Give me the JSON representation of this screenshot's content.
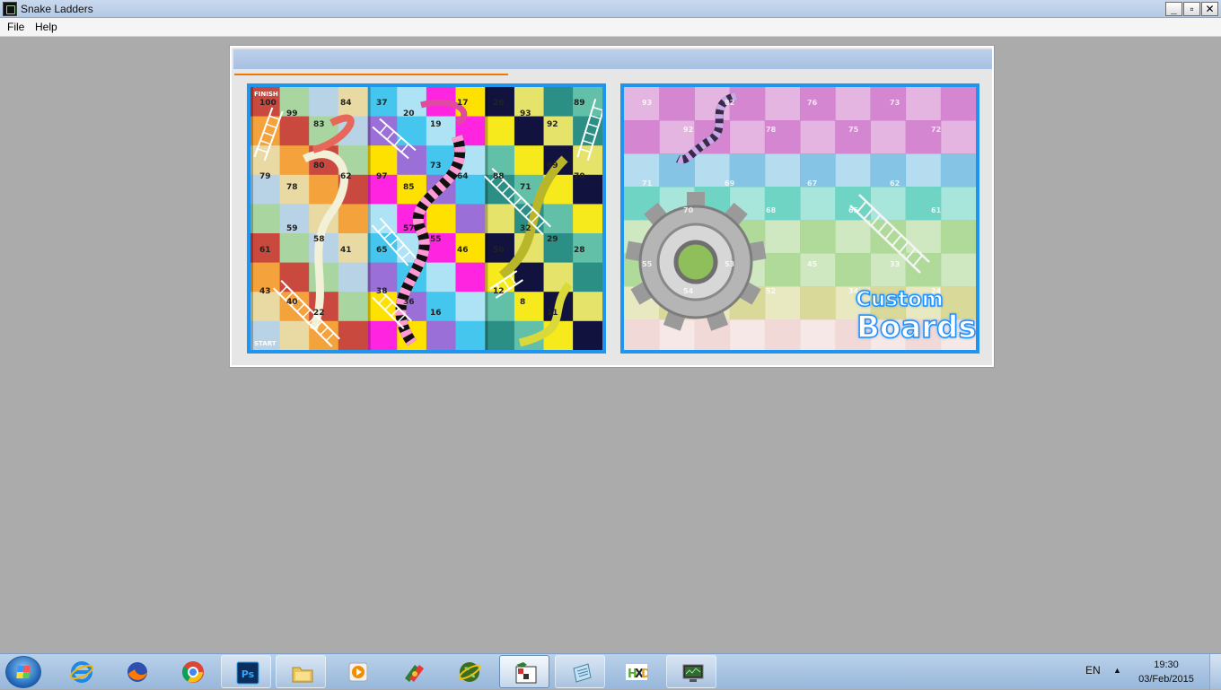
{
  "window": {
    "title": "Snake Ladders",
    "minimize_glyph": "_",
    "maximize_glyph": "▫",
    "close_glyph": "✕"
  },
  "menu": {
    "items": [
      "File",
      "Help"
    ]
  },
  "board_classic": {
    "column_colors": [
      "#c9493f",
      "#ff24e0",
      "#f6ea1d"
    ],
    "visible_numbers": [
      "100",
      "99",
      "83",
      "84",
      "79",
      "78",
      "80",
      "62",
      "61",
      "59",
      "58",
      "41",
      "43",
      "40",
      "22",
      "37",
      "20",
      "19",
      "17",
      "97",
      "85",
      "73",
      "64",
      "65",
      "57",
      "55",
      "46",
      "38",
      "36",
      "16",
      "26",
      "93",
      "92",
      "89",
      "88",
      "71",
      "69",
      "70",
      "50",
      "32",
      "29",
      "28",
      "12",
      "8",
      "11"
    ],
    "labels": [
      "FINISH",
      "START"
    ]
  },
  "board_custom": {
    "label_line1": "Custom",
    "label_line2": "Boards",
    "visible_numbers": [
      "93",
      "92",
      "82",
      "78",
      "76",
      "75",
      "73",
      "72",
      "71",
      "70",
      "69",
      "68",
      "67",
      "65",
      "62",
      "61",
      "55",
      "54",
      "53",
      "52",
      "45",
      "34",
      "33",
      "24"
    ]
  },
  "taskbar": {
    "icons": [
      "internet-explorer-icon",
      "firefox-icon",
      "chrome-icon",
      "photoshop-icon",
      "file-explorer-icon",
      "media-player-icon",
      "app-icon",
      "globe-icon",
      "snake-ladders-icon",
      "notepad-icon",
      "hxd-icon",
      "monitor-icon"
    ],
    "language": "EN",
    "tray_arrow": "▲",
    "time": "19:30",
    "date": "03/Feb/2015"
  }
}
